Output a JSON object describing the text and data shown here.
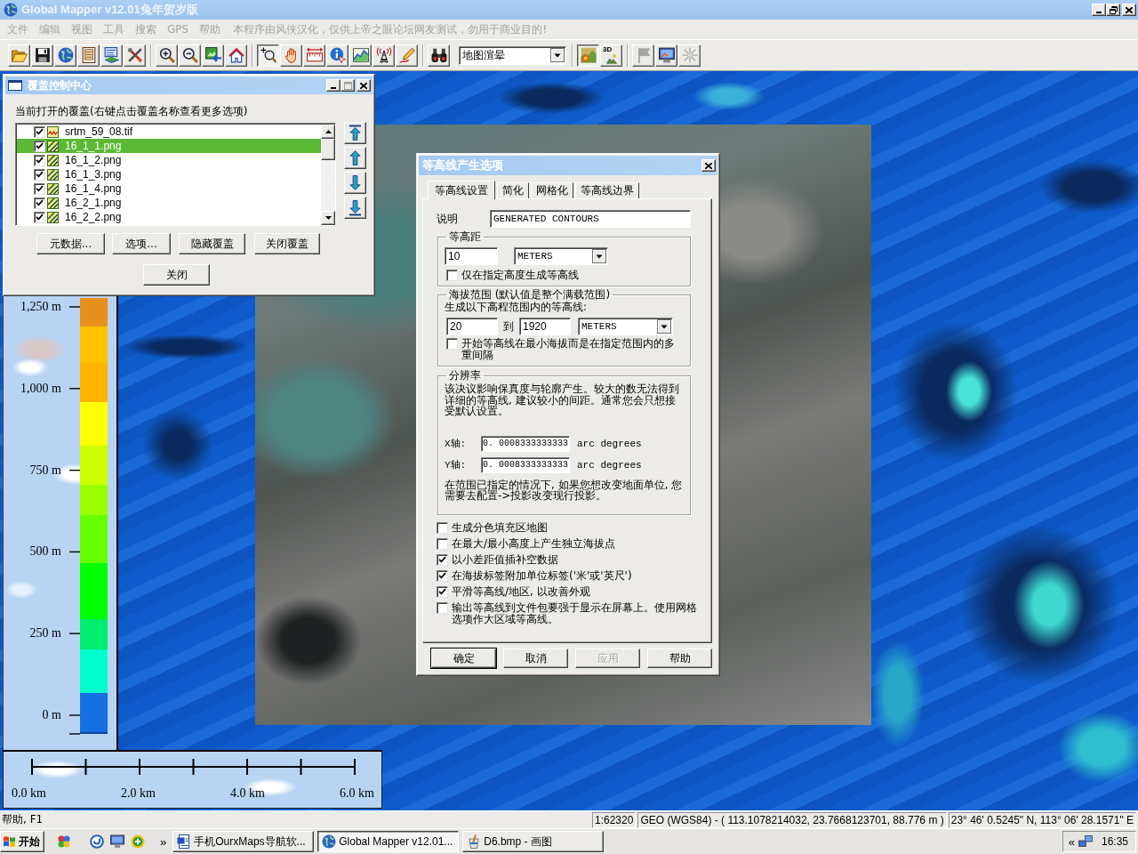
{
  "window": {
    "title": "Global Mapper v12.01兔年贺岁版"
  },
  "menu": [
    {
      "label": "文件",
      "disabled": true
    },
    {
      "label": "编辑",
      "disabled": true
    },
    {
      "label": "视图",
      "disabled": true
    },
    {
      "label": "工具",
      "disabled": true
    },
    {
      "label": "搜索",
      "disabled": true
    },
    {
      "label": "GPS",
      "disabled": true
    },
    {
      "label": "帮助",
      "disabled": true
    }
  ],
  "menu_notice": "本程序由风侠汉化，仅供上帝之眼论坛网友测试，勿用于商业目的!",
  "toolbar": [
    {
      "kind": "group",
      "buttons": [
        {
          "pressed": false,
          "disabled": false
        },
        {
          "pressed": false,
          "disabled": false
        },
        {
          "pressed": false,
          "disabled": false
        },
        {
          "pressed": false,
          "disabled": false
        },
        {
          "pressed": false,
          "disabled": false
        },
        {
          "pressed": false,
          "disabled": false
        }
      ]
    },
    {
      "kind": "group",
      "buttons": [
        {
          "pressed": false,
          "disabled": false
        },
        {
          "pressed": false,
          "disabled": false
        },
        {
          "pressed": false,
          "disabled": false
        },
        {
          "pressed": false,
          "disabled": false
        }
      ]
    },
    {
      "kind": "group",
      "buttons": [
        {
          "pressed": true,
          "disabled": false
        },
        {
          "pressed": false,
          "disabled": false
        },
        {
          "pressed": false,
          "disabled": false
        },
        {
          "pressed": false,
          "disabled": false
        },
        {
          "pressed": false,
          "disabled": false
        },
        {
          "pressed": false,
          "disabled": false
        },
        {
          "pressed": false,
          "disabled": false
        }
      ]
    },
    {
      "kind": "group",
      "buttons": [
        {
          "pressed": false,
          "disabled": false
        }
      ]
    },
    {
      "kind": "combo",
      "value": "地图渲晕"
    },
    {
      "kind": "group",
      "buttons": [
        {
          "pressed": true,
          "disabled": false
        },
        {
          "pressed": false,
          "disabled": false,
          "label": "3D"
        }
      ]
    },
    {
      "kind": "group",
      "buttons": [
        {
          "pressed": false,
          "disabled": true
        },
        {
          "pressed": false,
          "disabled": false
        },
        {
          "pressed": false,
          "disabled": true
        }
      ]
    }
  ],
  "legend": {
    "labels": [
      "1,250 m",
      "1,000 m",
      "750 m",
      "500 m",
      "250 m",
      "0 m"
    ]
  },
  "scale_bar": {
    "labels": [
      "0.0 km",
      "2.0 km",
      "4.0 km",
      "6.0 km"
    ]
  },
  "layer_panel": {
    "title": "覆盖控制中心",
    "maximize_disabled": true,
    "caption": "当前打开的覆盖(右键点击覆盖名称查看更多选项)",
    "layers": [
      {
        "name": "srtm_59_08.tif",
        "kind": "elevation",
        "checked": true,
        "selected": false
      },
      {
        "name": "16_1_1.png",
        "kind": "raster",
        "checked": true,
        "selected": true
      },
      {
        "name": "16_1_2.png",
        "kind": "raster",
        "checked": true,
        "selected": false
      },
      {
        "name": "16_1_3.png",
        "kind": "raster",
        "checked": true,
        "selected": false
      },
      {
        "name": "16_1_4.png",
        "kind": "raster",
        "checked": true,
        "selected": false
      },
      {
        "name": "16_2_1.png",
        "kind": "raster",
        "checked": true,
        "selected": false
      },
      {
        "name": "16_2_2.png",
        "kind": "raster",
        "checked": true,
        "selected": false
      }
    ],
    "buttons": [
      "元数据...",
      "选项...",
      "隐藏覆盖",
      "关闭覆盖"
    ],
    "close_button": "关闭"
  },
  "contour_dialog": {
    "title": "等高线产生选项",
    "tabs": [
      {
        "label": "等高线设置",
        "selected": true
      },
      {
        "label": "简化",
        "selected": false
      },
      {
        "label": "网格化",
        "selected": false
      },
      {
        "label": "等高线边界",
        "selected": false
      }
    ],
    "description": {
      "label": "说明",
      "value": "GENERATED CONTOURS"
    },
    "interval": {
      "title": "等高距",
      "value": "10",
      "unit": "METERS",
      "option": {
        "label": "仅在指定高度生成等高线",
        "checked": false
      }
    },
    "range": {
      "title": "海拔范围 (默认值是整个满载范围)",
      "caption": "生成以下高程范围内的等高线:",
      "from": "20",
      "to_label": "到",
      "to": "1920",
      "unit": "METERS",
      "option": {
        "label": "开始等高线在最小海拔而是在指定范围内的多重间隔",
        "checked": false
      }
    },
    "resolution": {
      "title": "分辨率",
      "note": "该决议影响保真度与轮廓产生。较大的数无法得到详细的等高线, 建议较小的间距。通常您会只想接受默认设置。",
      "axes": [
        {
          "label": "X轴:",
          "value": "0. 0008333333333",
          "unit": "arc degrees"
        },
        {
          "label": "Y轴:",
          "value": "0. 0008333333333",
          "unit": "arc degrees"
        }
      ],
      "footnote": "在范围已指定的情况下, 如果您想改变地面单位, 您需要去配置->投影改变现行投影。"
    },
    "options": [
      {
        "label": "生成分色填充区地图",
        "checked": false
      },
      {
        "label": "在最大/最小高度上产生独立海拔点",
        "checked": false
      },
      {
        "label": "以小差距值插补空数据",
        "checked": true
      },
      {
        "label": "在海拔标签附加单位标签('米'或'英尺')",
        "checked": true
      },
      {
        "label": "平滑等高线/地区, 以改善外观",
        "checked": true
      },
      {
        "label": "输出等高线到文件包要强于显示在屏幕上。使用网格选项作大区域等高线。",
        "checked": false
      }
    ],
    "buttons": [
      {
        "label": "确定",
        "default": true,
        "disabled": false
      },
      {
        "label": "取消",
        "default": false,
        "disabled": false
      },
      {
        "label": "应用",
        "default": false,
        "disabled": true
      },
      {
        "label": "帮助",
        "default": false,
        "disabled": false
      }
    ]
  },
  "status_bar": {
    "help": "帮助, F1",
    "scale": "1:62320",
    "position": "GEO (WGS84) - ( 113.1078214032, 23.7668123701, 88.776 m )",
    "coordinates": "23° 46' 0.5245\" N, 113° 06' 28.1571\" E"
  },
  "taskbar": {
    "start": "开始",
    "more": "»",
    "tasks": [
      {
        "label": "手机OurxMaps导航软...",
        "selected": false
      },
      {
        "label": "Global Mapper v12.01...",
        "selected": true
      },
      {
        "label": "D6.bmp - 画图",
        "selected": false
      }
    ],
    "tray_toggle": "«",
    "clock": "16:35"
  }
}
